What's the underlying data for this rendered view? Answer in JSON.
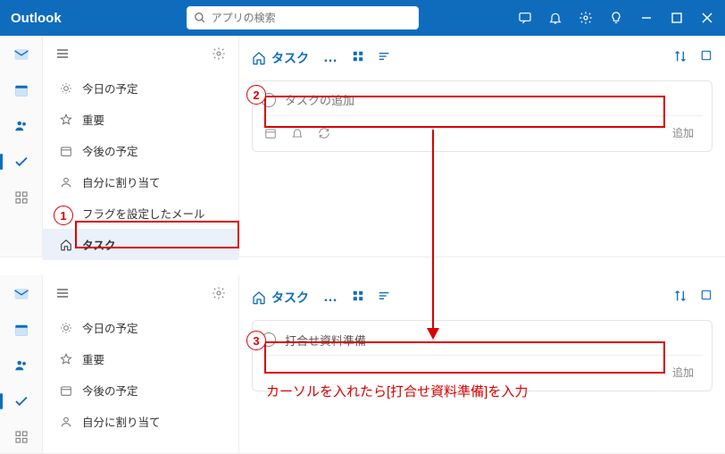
{
  "titlebar": {
    "brand": "Outlook",
    "search_placeholder": "アプリの検索"
  },
  "panel1": {
    "sidebar": {
      "items": [
        {
          "label": "今日の予定"
        },
        {
          "label": "重要"
        },
        {
          "label": "今後の予定"
        },
        {
          "label": "自分に割り当て"
        },
        {
          "label": "フラグを設定したメール"
        },
        {
          "label": "タスク"
        }
      ]
    },
    "header": {
      "title": "タスク",
      "dots": "…"
    },
    "task": {
      "placeholder": "タスクの追加",
      "add_button": "追加"
    }
  },
  "panel2": {
    "sidebar": {
      "items": [
        {
          "label": "今日の予定"
        },
        {
          "label": "重要"
        },
        {
          "label": "今後の予定"
        },
        {
          "label": "自分に割り当て"
        }
      ]
    },
    "header": {
      "title": "タスク",
      "dots": "…"
    },
    "task": {
      "value": "打合せ資料準備",
      "add_button": "追加"
    }
  },
  "annotations": {
    "step1": "1",
    "step2": "2",
    "step3": "3",
    "instruction": "カーソルを入れたら[打合せ資料準備]を入力"
  }
}
